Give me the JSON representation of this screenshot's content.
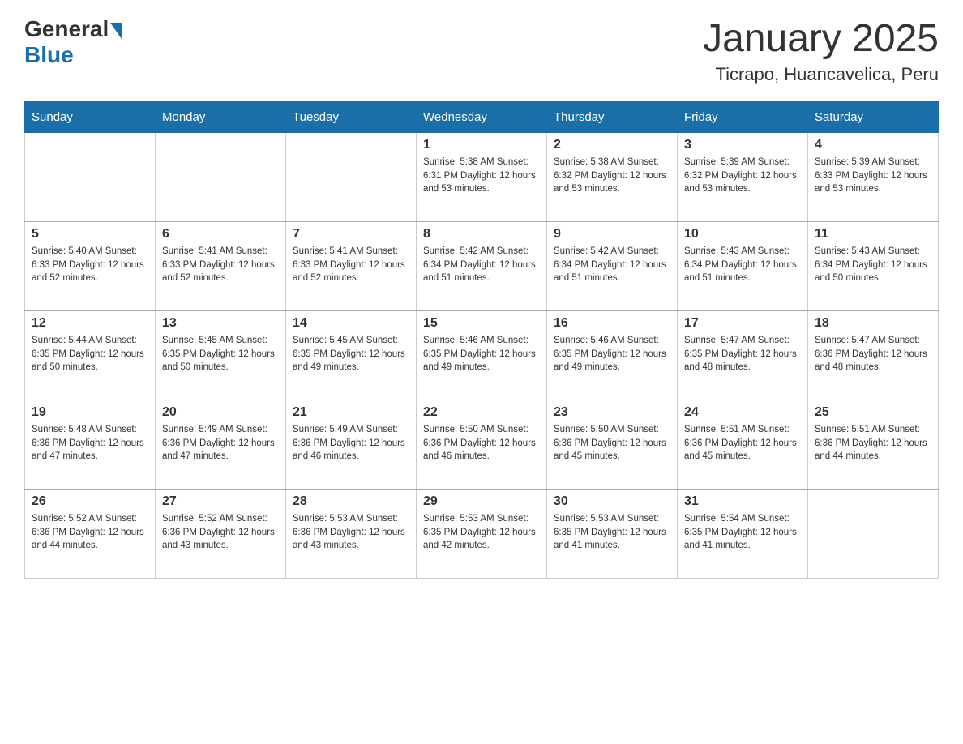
{
  "header": {
    "title": "January 2025",
    "subtitle": "Ticrapo, Huancavelica, Peru",
    "logo_general": "General",
    "logo_blue": "Blue"
  },
  "days_of_week": [
    "Sunday",
    "Monday",
    "Tuesday",
    "Wednesday",
    "Thursday",
    "Friday",
    "Saturday"
  ],
  "weeks": [
    [
      {
        "day": "",
        "info": ""
      },
      {
        "day": "",
        "info": ""
      },
      {
        "day": "",
        "info": ""
      },
      {
        "day": "1",
        "info": "Sunrise: 5:38 AM\nSunset: 6:31 PM\nDaylight: 12 hours and 53 minutes."
      },
      {
        "day": "2",
        "info": "Sunrise: 5:38 AM\nSunset: 6:32 PM\nDaylight: 12 hours and 53 minutes."
      },
      {
        "day": "3",
        "info": "Sunrise: 5:39 AM\nSunset: 6:32 PM\nDaylight: 12 hours and 53 minutes."
      },
      {
        "day": "4",
        "info": "Sunrise: 5:39 AM\nSunset: 6:33 PM\nDaylight: 12 hours and 53 minutes."
      }
    ],
    [
      {
        "day": "5",
        "info": "Sunrise: 5:40 AM\nSunset: 6:33 PM\nDaylight: 12 hours and 52 minutes."
      },
      {
        "day": "6",
        "info": "Sunrise: 5:41 AM\nSunset: 6:33 PM\nDaylight: 12 hours and 52 minutes."
      },
      {
        "day": "7",
        "info": "Sunrise: 5:41 AM\nSunset: 6:33 PM\nDaylight: 12 hours and 52 minutes."
      },
      {
        "day": "8",
        "info": "Sunrise: 5:42 AM\nSunset: 6:34 PM\nDaylight: 12 hours and 51 minutes."
      },
      {
        "day": "9",
        "info": "Sunrise: 5:42 AM\nSunset: 6:34 PM\nDaylight: 12 hours and 51 minutes."
      },
      {
        "day": "10",
        "info": "Sunrise: 5:43 AM\nSunset: 6:34 PM\nDaylight: 12 hours and 51 minutes."
      },
      {
        "day": "11",
        "info": "Sunrise: 5:43 AM\nSunset: 6:34 PM\nDaylight: 12 hours and 50 minutes."
      }
    ],
    [
      {
        "day": "12",
        "info": "Sunrise: 5:44 AM\nSunset: 6:35 PM\nDaylight: 12 hours and 50 minutes."
      },
      {
        "day": "13",
        "info": "Sunrise: 5:45 AM\nSunset: 6:35 PM\nDaylight: 12 hours and 50 minutes."
      },
      {
        "day": "14",
        "info": "Sunrise: 5:45 AM\nSunset: 6:35 PM\nDaylight: 12 hours and 49 minutes."
      },
      {
        "day": "15",
        "info": "Sunrise: 5:46 AM\nSunset: 6:35 PM\nDaylight: 12 hours and 49 minutes."
      },
      {
        "day": "16",
        "info": "Sunrise: 5:46 AM\nSunset: 6:35 PM\nDaylight: 12 hours and 49 minutes."
      },
      {
        "day": "17",
        "info": "Sunrise: 5:47 AM\nSunset: 6:35 PM\nDaylight: 12 hours and 48 minutes."
      },
      {
        "day": "18",
        "info": "Sunrise: 5:47 AM\nSunset: 6:36 PM\nDaylight: 12 hours and 48 minutes."
      }
    ],
    [
      {
        "day": "19",
        "info": "Sunrise: 5:48 AM\nSunset: 6:36 PM\nDaylight: 12 hours and 47 minutes."
      },
      {
        "day": "20",
        "info": "Sunrise: 5:49 AM\nSunset: 6:36 PM\nDaylight: 12 hours and 47 minutes."
      },
      {
        "day": "21",
        "info": "Sunrise: 5:49 AM\nSunset: 6:36 PM\nDaylight: 12 hours and 46 minutes."
      },
      {
        "day": "22",
        "info": "Sunrise: 5:50 AM\nSunset: 6:36 PM\nDaylight: 12 hours and 46 minutes."
      },
      {
        "day": "23",
        "info": "Sunrise: 5:50 AM\nSunset: 6:36 PM\nDaylight: 12 hours and 45 minutes."
      },
      {
        "day": "24",
        "info": "Sunrise: 5:51 AM\nSunset: 6:36 PM\nDaylight: 12 hours and 45 minutes."
      },
      {
        "day": "25",
        "info": "Sunrise: 5:51 AM\nSunset: 6:36 PM\nDaylight: 12 hours and 44 minutes."
      }
    ],
    [
      {
        "day": "26",
        "info": "Sunrise: 5:52 AM\nSunset: 6:36 PM\nDaylight: 12 hours and 44 minutes."
      },
      {
        "day": "27",
        "info": "Sunrise: 5:52 AM\nSunset: 6:36 PM\nDaylight: 12 hours and 43 minutes."
      },
      {
        "day": "28",
        "info": "Sunrise: 5:53 AM\nSunset: 6:36 PM\nDaylight: 12 hours and 43 minutes."
      },
      {
        "day": "29",
        "info": "Sunrise: 5:53 AM\nSunset: 6:35 PM\nDaylight: 12 hours and 42 minutes."
      },
      {
        "day": "30",
        "info": "Sunrise: 5:53 AM\nSunset: 6:35 PM\nDaylight: 12 hours and 41 minutes."
      },
      {
        "day": "31",
        "info": "Sunrise: 5:54 AM\nSunset: 6:35 PM\nDaylight: 12 hours and 41 minutes."
      },
      {
        "day": "",
        "info": ""
      }
    ]
  ]
}
